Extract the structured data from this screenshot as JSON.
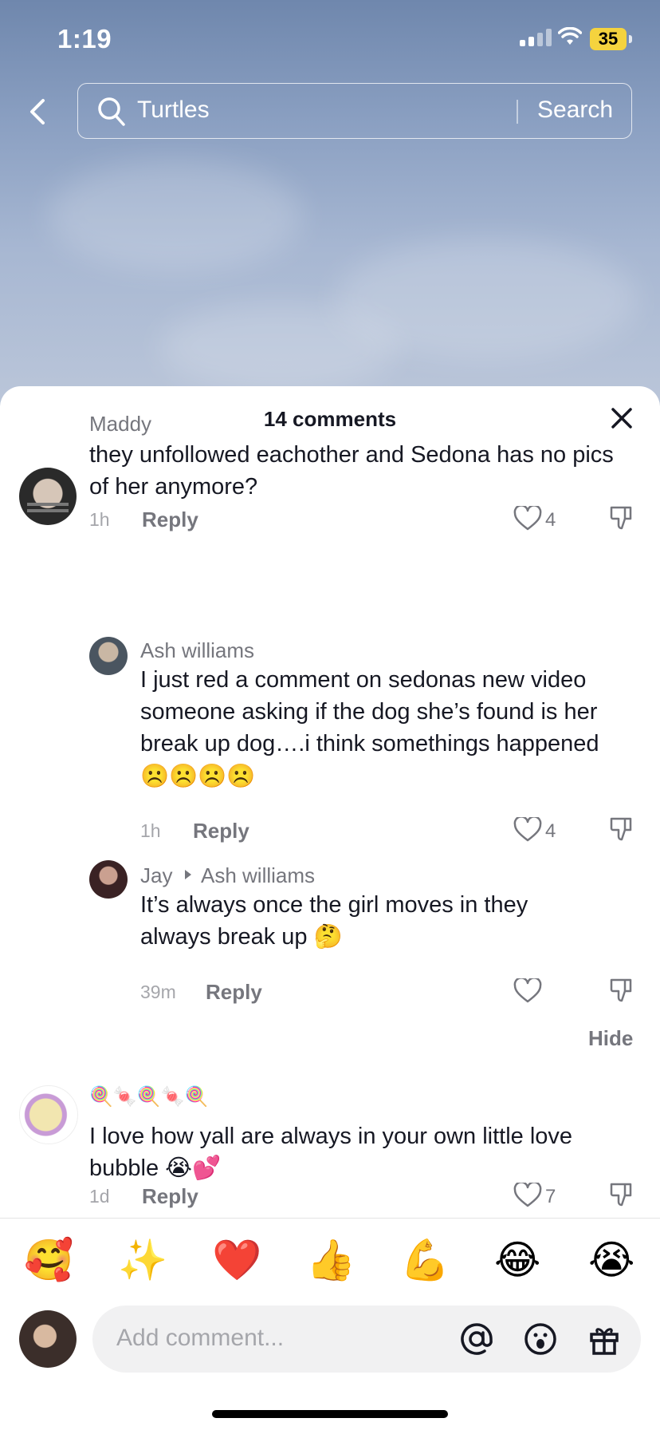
{
  "status_bar": {
    "time": "1:19",
    "battery": "35"
  },
  "search": {
    "query": "Turtles",
    "button_label": "Search"
  },
  "comments_sheet": {
    "title": "14 comments",
    "comments": [
      {
        "username": "Maddy",
        "text": "they unfollowed eachother and Sedona has no pics of her anymore?",
        "time": "1h",
        "reply_label": "Reply",
        "likes": "4"
      },
      {
        "username": "Ash williams",
        "text_line1": "I just red a comment on sedonas new video",
        "text_line2": "someone asking if the dog she’s found is her",
        "text_line3": "break up dog….i think somethings happened",
        "text_line4": "☹️☹️☹️☹️",
        "time": "1h",
        "reply_label": "Reply",
        "likes": "4"
      },
      {
        "username": "Jay",
        "reply_to": "Ash williams",
        "text": "It’s always once the girl moves in they always break up 🤔",
        "time": "39m",
        "reply_label": "Reply",
        "likes": ""
      },
      {
        "username": "🍭🍬🍭🍬🍭",
        "text": "I love how yall are always in your own little love bubble 😭💕",
        "time": "1d",
        "reply_label": "Reply",
        "likes": "7"
      }
    ],
    "hide_label": "Hide"
  },
  "quick_emojis": [
    "🥰",
    "✨",
    "❤️",
    "👍",
    "💪",
    "😂",
    "😭"
  ],
  "composer": {
    "placeholder": "Add comment..."
  },
  "colors": {
    "text_primary": "#161823",
    "text_secondary": "#75767d",
    "battery": "#f5d33e"
  }
}
